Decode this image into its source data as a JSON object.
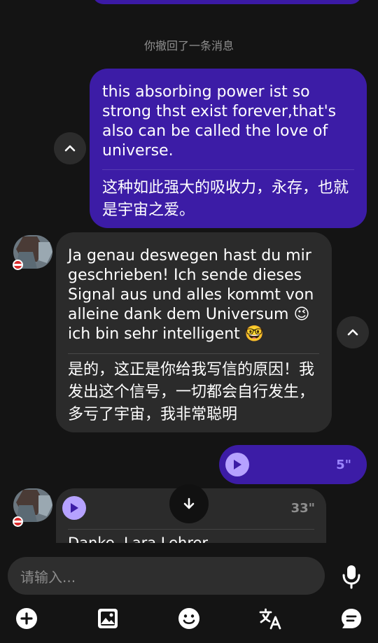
{
  "recall_notice": "你撤回了一条消息",
  "messages": [
    {
      "original": "this absorbing power ist so strong thst exist forever,that's also can be called the love of universe.",
      "translation": "这种如此强大的吸收力，永存，也就是宇宙之爱。"
    },
    {
      "original": "Ja genau deswegen hast du mir geschrieben! Ich sende dieses Signal aus und alles kommt von alleine dank dem Universum 😉 ich bin sehr intelligent 🤓",
      "translation": "是的，这正是你给我写信的原因！我发出这个信号，一切都会自行发生，多亏了宇宙，我非常聪明"
    }
  ],
  "voice_out": {
    "duration": "5\""
  },
  "voice_in": {
    "duration": "33\"",
    "partial_text": "Danke, Lara Lehrer"
  },
  "composer": {
    "placeholder": "请输入..."
  },
  "colors": {
    "outgoing": "#3c1ca6",
    "incoming": "#2b2b2b",
    "accent": "#b6a2ff",
    "flag": "#d92a2a"
  },
  "icons": [
    "chevron-up-icon",
    "play-icon",
    "arrow-down-icon",
    "mic-icon",
    "plus-icon",
    "image-icon",
    "emoji-icon",
    "translate-icon",
    "chat-icon"
  ]
}
